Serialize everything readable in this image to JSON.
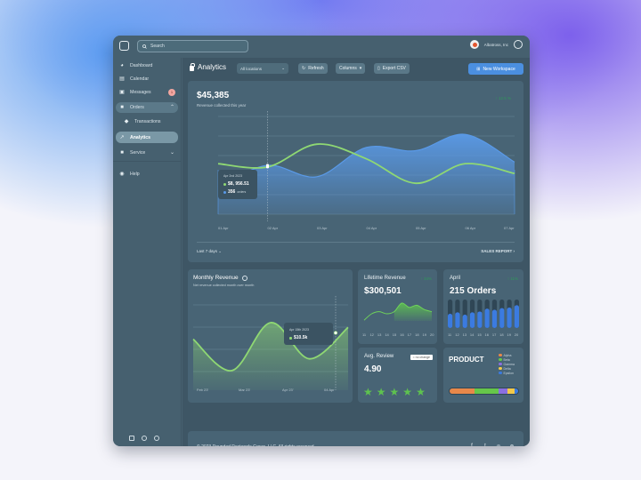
{
  "topbar": {
    "search_placeholder": "Search",
    "org_name": "Albatross, Inc"
  },
  "sidebar": {
    "items": [
      {
        "label": "Dashboard",
        "icon": "pie-chart-icon"
      },
      {
        "label": "Calendar",
        "icon": "calendar-icon"
      },
      {
        "label": "Messages",
        "icon": "inbox-icon",
        "badge": "1"
      },
      {
        "label": "Orders",
        "icon": "shopping-bag-icon",
        "expanded": true
      },
      {
        "label": "Transactions",
        "icon": "tag-icon"
      },
      {
        "label": "Analytics",
        "icon": "trending-up-icon",
        "selected": true
      },
      {
        "label": "Service",
        "icon": "lock-icon"
      },
      {
        "label": "Help",
        "icon": "help-icon"
      }
    ]
  },
  "toolbar": {
    "title": "Analytics",
    "location_select": "All locations",
    "refresh_label": "Refresh",
    "columns_label": "Columns",
    "export_label": "Export CSV",
    "new_workspace_label": "New Workspace"
  },
  "main_chart": {
    "value": "$45,385",
    "subtitle": "Revenue collected this year",
    "delta": "↑ 12.5 %",
    "tooltip": {
      "date": "Apr 2nd 2023",
      "revenue": "$8, 956.51",
      "orders": "356",
      "orders_label": "orders"
    },
    "range_label": "Last 7 days",
    "report_link": "SALES REPORT",
    "colors": {
      "revenue": "#8fd873",
      "orders": "#5a9ae8"
    }
  },
  "monthly": {
    "title": "Monthly Revenue",
    "subtitle": "Net revenue collected month over month",
    "tooltip_date": "Apr 15th 2023",
    "tooltip_value": "$10.5k"
  },
  "lifetime": {
    "title": "Lifetime Revenue",
    "delta": "↑ 34%",
    "value": "$300,501"
  },
  "april": {
    "title": "April",
    "delta": "↑ 11%",
    "value": "215 Orders"
  },
  "review": {
    "title": "Avg. Review",
    "value": "4.90",
    "badge": "= no change",
    "stars": 5
  },
  "product": {
    "title": "PRODUCT",
    "legend": [
      "Alpha",
      "Beta",
      "Gamma",
      "Delta",
      "Epsilon"
    ],
    "colors": [
      "#e8884a",
      "#66c64a",
      "#8a6fe0",
      "#f2c94a",
      "#3b7be0"
    ],
    "shares": [
      0.37,
      0.34,
      0.14,
      0.1,
      0.05
    ]
  },
  "footer": {
    "copyright": "© 2023 Rounded Rectangle Group, LLC. All rights reserved."
  },
  "chart_data": [
    {
      "type": "area",
      "title": "$45,385",
      "x": [
        "01 Apr",
        "02 Apr",
        "03 Apr",
        "04 Apr",
        "05 Apr",
        "06 Apr",
        "07 Apr"
      ],
      "series": [
        {
          "name": "Revenue",
          "values": [
            6.2,
            5.8,
            8.6,
            6.8,
            3.8,
            6.2,
            5.0
          ]
        },
        {
          "name": "Orders",
          "values": [
            3.4,
            6.0,
            4.6,
            8.2,
            7.8,
            9.8,
            6.4
          ]
        }
      ],
      "ylim": [
        0,
        12
      ],
      "grid": true
    },
    {
      "type": "area",
      "title": "Monthly Revenue",
      "x": [
        "Feb 23'",
        "Mar 23'",
        "Apr 23'",
        "04 Apr"
      ],
      "series": [
        {
          "name": "Revenue",
          "values": [
            6.5,
            2.5,
            8.6,
            4.0,
            8.0
          ]
        }
      ],
      "ylim": [
        0,
        12
      ],
      "grid": true
    },
    {
      "type": "area",
      "title": "Lifetime Revenue",
      "x": [
        "11",
        "12",
        "13",
        "14",
        "15",
        "16",
        "17",
        "18",
        "19",
        "20"
      ],
      "series": [
        {
          "name": "Revenue",
          "values": [
            2,
            5,
            6,
            5,
            6,
            10,
            8,
            9,
            7,
            6
          ]
        }
      ]
    },
    {
      "type": "bar",
      "title": "April",
      "categories": [
        "11",
        "12",
        "13",
        "14",
        "15",
        "16",
        "17",
        "18",
        "19",
        "20"
      ],
      "values": [
        50,
        55,
        47,
        55,
        58,
        68,
        64,
        70,
        72,
        80
      ],
      "ylim": [
        0,
        100
      ]
    }
  ]
}
